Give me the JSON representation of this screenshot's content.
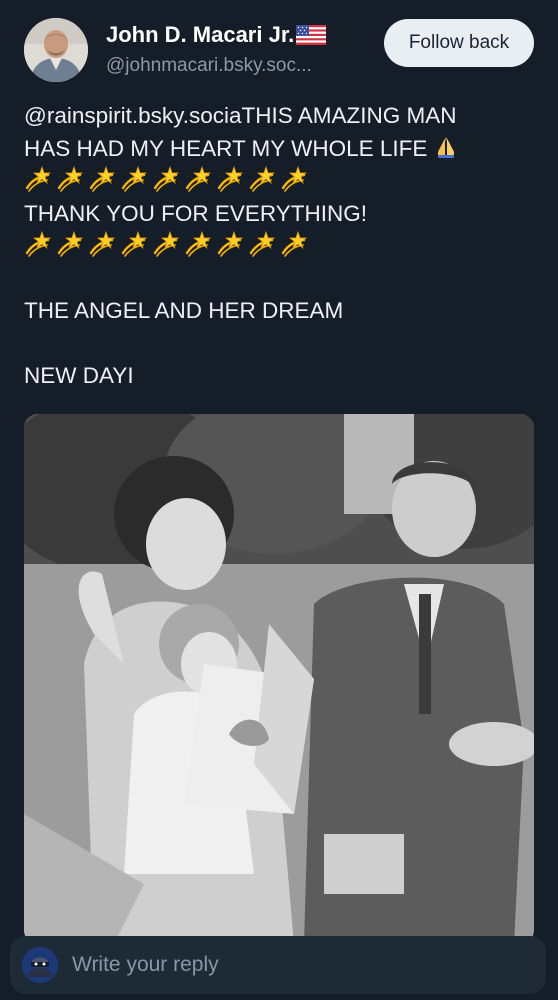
{
  "author": {
    "name": "John D. Macari Jr.",
    "flag_icon": "us-flag-icon",
    "handle": "@johnmacari.bsky.soc...",
    "follow_label": "Follow back"
  },
  "post": {
    "lines": [
      "@rainspirit.bsky.sociaTHIS AMAZING MAN",
      "HAS HAD MY HEART MY WHOLE LIFE",
      "THANK YOU FOR EVERYTHING!",
      "THE ANGEL AND HER DREAM",
      "NEW DAYI"
    ],
    "emoji": {
      "pray": "folded-hands-icon",
      "dizzy": "dizzy-star-icon",
      "dizzy_count_per_row": 9
    }
  },
  "reply": {
    "placeholder": "Write your reply"
  },
  "colors": {
    "background": "#151d28",
    "follow_button_bg": "#e9eef3",
    "reply_bar_bg": "#1f2a37",
    "handle_text": "#8d99a6"
  }
}
